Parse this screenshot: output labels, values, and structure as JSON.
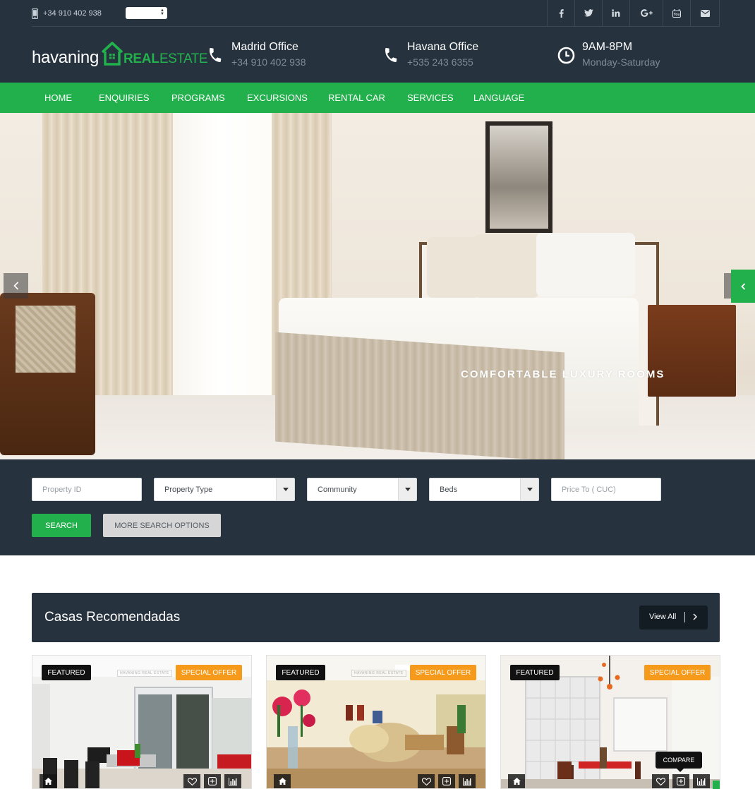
{
  "topbar": {
    "phone": "+34 910 402 938",
    "language_select": {
      "value": ""
    },
    "social": [
      {
        "name": "facebook-icon",
        "glyph": "f"
      },
      {
        "name": "twitter-icon",
        "glyph": "t"
      },
      {
        "name": "linkedin-icon",
        "glyph": "in"
      },
      {
        "name": "google-plus-icon",
        "glyph": "G+"
      },
      {
        "name": "youtube-icon",
        "glyph": "yt"
      },
      {
        "name": "envelope-icon",
        "glyph": "mail"
      }
    ]
  },
  "header": {
    "logo": {
      "word": "havaning",
      "real": "REAL",
      "estate": "ESTATE"
    },
    "contacts": [
      {
        "icon": "phone-icon",
        "title": "Madrid Office",
        "detail": "+34 910 402 938"
      },
      {
        "icon": "phone-icon",
        "title": "Havana Office",
        "detail": "+535 243 6355"
      },
      {
        "icon": "clock-icon",
        "title": "9AM-8PM",
        "detail": "Monday-Saturday"
      }
    ]
  },
  "nav": {
    "items": [
      "HOME",
      "ENQUIRIES",
      "PROGRAMS",
      "EXCURSIONS",
      "RENTAL CAR",
      "SERVICES",
      "LANGUAGE"
    ]
  },
  "hero": {
    "caption": "COMFORTABLE LUXURY ROOMS"
  },
  "search": {
    "property_id_placeholder": "Property ID",
    "property_type": "Property Type",
    "community": "Community",
    "beds": "Beds",
    "price_placeholder": "Price To ( CUC)",
    "search_button": "SEARCH",
    "more_button": "MORE SEARCH OPTIONS"
  },
  "section": {
    "title": "Casas Recomendadas",
    "view_all": "View All"
  },
  "cards": [
    {
      "featured": "FEATURED",
      "offer": "SPECIAL OFFER",
      "watermark": "HAVANING REAL ESTATE"
    },
    {
      "featured": "FEATURED",
      "offer": "SPECIAL OFFER",
      "watermark": "HAVANING REAL ESTATE"
    },
    {
      "featured": "FEATURED",
      "offer": "SPECIAL OFFER",
      "watermark": ""
    }
  ],
  "tooltip": {
    "compare": "COMPARE"
  },
  "colors": {
    "dark": "#26323e",
    "green": "#21b04b",
    "orange": "#f59a1b",
    "black": "#111111"
  }
}
